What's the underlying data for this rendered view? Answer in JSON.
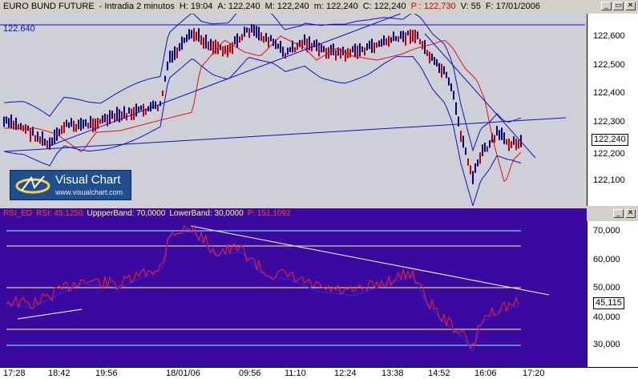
{
  "window": {
    "instrument": "EURO BUND FUTURE",
    "timeframe": "- Intradia 2 minutos",
    "h": "H: 19:04",
    "a": "A: 122,240",
    "m_upper": "M: 122,240",
    "m_lower": "m: 122,240",
    "c": "C: 122,240",
    "p": "P : 122,730",
    "v": "V: 55",
    "f": "F: 17/01/2006"
  },
  "price_chart": {
    "level_label": "122.640",
    "price_ticks": [
      "122,600",
      "122,500",
      "122,400",
      "122,300",
      "122,200",
      "122,100"
    ],
    "last_price": "122,240"
  },
  "logo": {
    "title": "Visual Chart",
    "url": "www.visualchart.com"
  },
  "rsi_chart": {
    "name": "RSI_ED",
    "rsi_label": "RSI: 45,1250",
    "upper_label": "UppperBand: 70,0000",
    "lower_label": "LowerBand: 30,0000",
    "p_label": "P: 151,1092",
    "ticks": [
      "70,000",
      "60,000",
      "50,000",
      "40,000",
      "30,000"
    ],
    "last_value": "45,115"
  },
  "time_axis": [
    "17:28",
    "18:42",
    "19:56",
    "18/01/06",
    "09:56",
    "11:10",
    "12:24",
    "13:38",
    "14:52",
    "16:06",
    "17:20"
  ],
  "colors": {
    "price_bg": "#cfcfd8",
    "rsi_bg": "#3a0aa0",
    "bollinger": "#1010c0",
    "moving_average": "#e01010",
    "candles_up": "#000080",
    "candles_down": "#c00000",
    "rsi_line": "#ff2020",
    "band_line": "#ffff80",
    "grid_line": "#80ffff"
  }
}
